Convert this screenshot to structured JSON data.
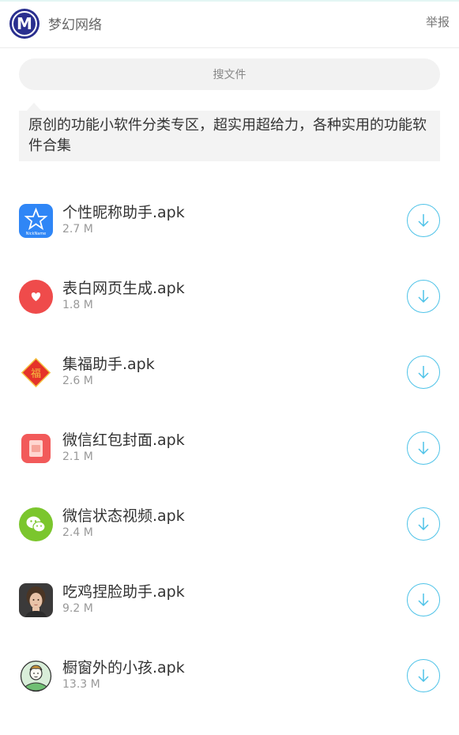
{
  "header": {
    "site_name": "梦幻网络",
    "report_label": "举报",
    "logo_letter": "M"
  },
  "search": {
    "label": "搜文件"
  },
  "description": "原创的功能小软件分类专区，超实用超给力，各种实用的功能软件合集",
  "files": [
    {
      "name": "个性昵称助手.apk",
      "size": "2.7 M",
      "icon": "nickname-icon"
    },
    {
      "name": "表白网页生成.apk",
      "size": "1.8 M",
      "icon": "heart-icon"
    },
    {
      "name": "集福助手.apk",
      "size": "2.6 M",
      "icon": "fu-icon"
    },
    {
      "name": "微信红包封面.apk",
      "size": "2.1 M",
      "icon": "red-envelope-icon"
    },
    {
      "name": "微信状态视频.apk",
      "size": "2.4 M",
      "icon": "wechat-icon"
    },
    {
      "name": "吃鸡捏脸助手.apk",
      "size": "9.2 M",
      "icon": "face-avatar-icon"
    },
    {
      "name": "橱窗外的小孩.apk",
      "size": "13.3 M",
      "icon": "child-icon"
    }
  ],
  "colors": {
    "accent": "#4fc3e8",
    "logo": "#2a2f8f"
  }
}
